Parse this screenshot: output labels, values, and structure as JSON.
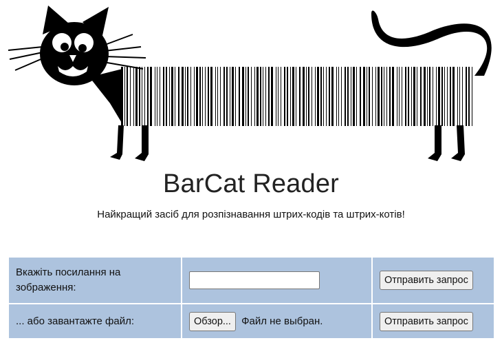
{
  "header": {
    "title": "BarCat Reader",
    "subtitle": "Найкращий засіб для розпізнавання штрих-кодів та штрих-котів!"
  },
  "logo": {
    "icon": "barcode-cat-logo"
  },
  "form": {
    "url_label": "Вкажіть посилання на зображення:",
    "url_value": "",
    "url_submit": "Отправить запрос",
    "file_label": "... або завантажте файл:",
    "file_browse": "Обзор...",
    "file_status": "Файл не выбран.",
    "file_submit": "Отправить запрос"
  },
  "colors": {
    "form_background": "#adc3de",
    "border": "#ffffff"
  }
}
